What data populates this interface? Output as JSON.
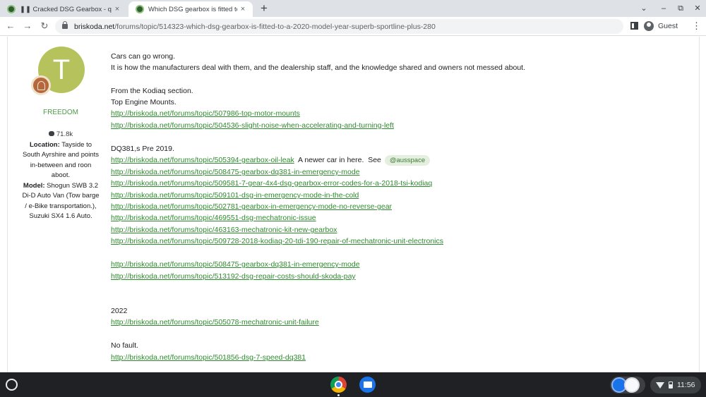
{
  "browser": {
    "tabs": [
      {
        "title": "❚❚ Cracked DSG Gearbox - quote",
        "close": "×"
      },
      {
        "title": "Which DSG gearbox is fitted to a",
        "close": "×"
      }
    ],
    "new_tab": "+",
    "window_controls": {
      "tab_search": "⌄",
      "minimize": "–",
      "restore": "⧉",
      "close": "✕"
    },
    "nav": {
      "back": "←",
      "forward": "→",
      "reload": "↻"
    },
    "url": {
      "host": "briskoda.net",
      "path": "/forums/topic/514323-which-dsg-gearbox-is-fitted-to-a-2020-model-year-superb-sportline-plus-280"
    },
    "profile_label": "Guest",
    "menu": "⋮"
  },
  "author": {
    "avatar_letter": "T",
    "group": "FREEDOM",
    "post_count": "71.8k",
    "location_label": "Location:",
    "location_value": "Tayside to South Ayrshire and points in-between and roon aboot.",
    "model_label": "Model:",
    "model_value": "Shogun SWB 3.2 Di-D Auto Van (Tow barge / e-Bike transportation.), Suzuki SX4 1.6 Auto."
  },
  "post": {
    "line1": "Cars can go wrong.",
    "line2": "It is how the manufacturers deal with them, and the dealership staff, and the knowledge shared and owners not messed about.",
    "kodiaq_intro": "From the Kodiaq section.",
    "top_mounts": "Top Engine Mounts.",
    "link_mounts_1": "http://briskoda.net/forums/topic/507986-top-motor-mounts",
    "link_mounts_2": "http://briskoda.net/forums/topic/504536-slight-noise-when-accelerating-and-turning-left",
    "dq381_intro": "DQ381,s  Pre 2019.",
    "link_oil_leak": "http://briskoda.net/forums/topic/505394-gearbox-oil-leak",
    "newer_car_text": "  A newer car in here.  See ",
    "mention": "@ausspace",
    "links_dq381": [
      "http://briskoda.net/forums/topic/508475-gearbox-dq381-in-emergency-mode",
      "http://briskoda.net/forums/topic/509581-7-gear-4x4-dsg-gearbox-error-codes-for-a-2018-tsi-kodiaq",
      "http://briskoda.net/forums/topic/509101-dsg-in-emergency-mode-in-the-cold",
      "http://briskoda.net/forums/topic/502781-gearbox-in-emergency-mode-no-reverse-gear",
      "http://briskoda.net/forums/topic/469551-dsg-mechatronic-issue",
      "http://briskoda.net/forums/topic/463163-mechatronic-kit-new-gearbox",
      "http://briskoda.net/forums/topic/509728-2018-kodiaq-20-tdi-190-repair-of-mechatronic-unit-electronics"
    ],
    "link_emergency_again": "http://briskoda.net/forums/topic/508475-gearbox-dq381-in-emergency-mode",
    "link_repair_costs": "http://briskoda.net/forums/topic/513192-dsg-repair-costs-should-skoda-pay",
    "year_2022": "2022",
    "link_mechatronic_failure": "http://briskoda.net/forums/topic/505078-mechatronic-unit-failure",
    "no_fault": "No fault.",
    "link_7_speed": "http://briskoda.net/forums/topic/501856-dsg-7-speed-dq381"
  },
  "shelf": {
    "time": "11:56"
  }
}
